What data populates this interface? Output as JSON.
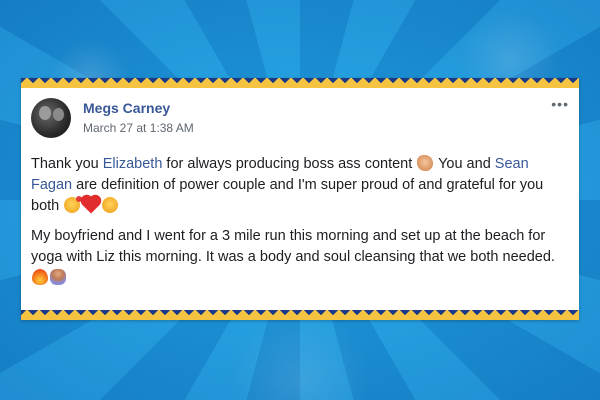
{
  "post": {
    "author": "Megs Carney",
    "timestamp": "March 27 at 1:38 AM",
    "more_label": "•••",
    "para1": {
      "t1": "Thank you ",
      "mention1": "Elizabeth",
      "t2": " for always producing boss ass content ",
      "t3": " You and ",
      "mention2": "Sean Fagan",
      "t4": " are definition of power couple and I'm super proud of and grateful for you both "
    },
    "para2": {
      "text": "My boyfriend and I went for a 3 mile run this morning and set up at the beach for yoga with Liz this morning. It was a body and soul cleansing that we both needed. "
    }
  },
  "icons": {
    "avatar": "profile-photo",
    "emojis_para1": [
      "clapping-hands-emoji",
      "smiling-face-with-hearts-emoji",
      "red-heart-emoji",
      "face-blowing-kiss-emoji"
    ],
    "emojis_para2": [
      "fire-emoji",
      "person-in-lotus-position-emoji"
    ]
  },
  "colors": {
    "link": "#385898",
    "text": "#1c1e21",
    "meta": "#606770",
    "border_gold": "#f5c342",
    "border_navy": "#1b3b86",
    "background_blue": "#1e9ad8"
  }
}
